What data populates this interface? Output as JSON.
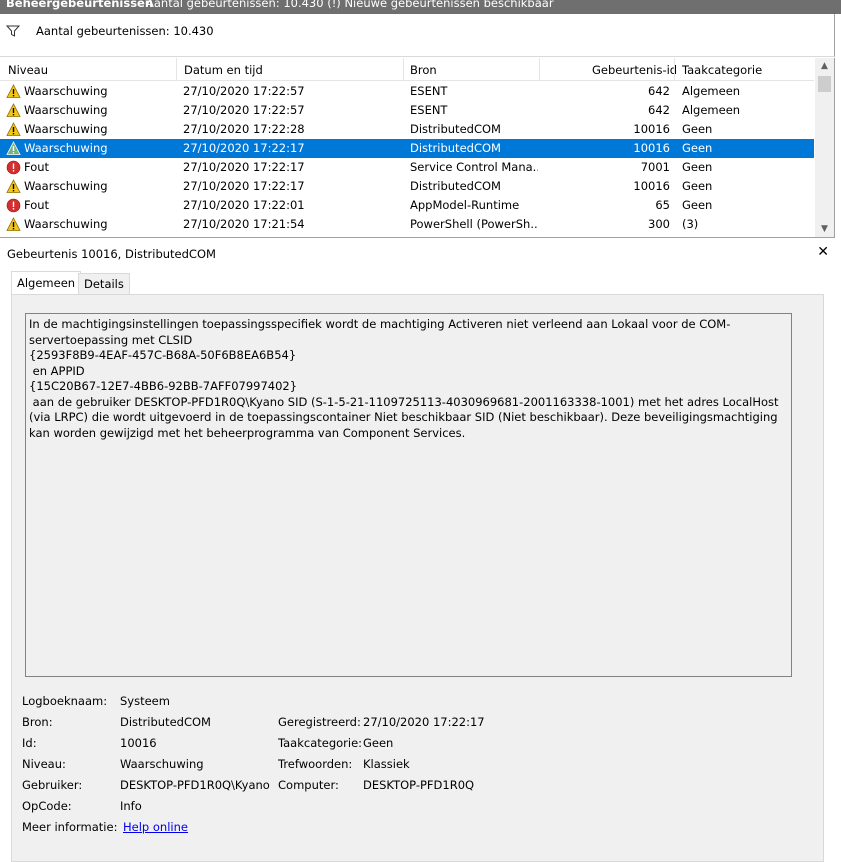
{
  "titlebar": {
    "title": "Beheergebeurtenissen",
    "status": "Aantal gebeurtenissen: 10.430 (!) Nieuwe gebeurtenissen beschikbaar"
  },
  "filterbar": {
    "icon": "filter-icon",
    "count_text": "Aantal gebeurtenissen: 10.430"
  },
  "event_list": {
    "columns": [
      "Niveau",
      "Datum en tijd",
      "Bron",
      "Gebeurtenis-id",
      "Taakcategorie"
    ],
    "rows": [
      {
        "level": "Waarschuwing",
        "icon": "warning-icon",
        "datetime": "27/10/2020 17:22:57",
        "source": "ESENT",
        "event_id": "642",
        "category": "Algemeen",
        "selected": false
      },
      {
        "level": "Waarschuwing",
        "icon": "warning-icon",
        "datetime": "27/10/2020 17:22:57",
        "source": "ESENT",
        "event_id": "642",
        "category": "Algemeen",
        "selected": false
      },
      {
        "level": "Waarschuwing",
        "icon": "warning-icon",
        "datetime": "27/10/2020 17:22:28",
        "source": "DistributedCOM",
        "event_id": "10016",
        "category": "Geen",
        "selected": false
      },
      {
        "level": "Waarschuwing",
        "icon": "warning-icon",
        "datetime": "27/10/2020 17:22:17",
        "source": "DistributedCOM",
        "event_id": "10016",
        "category": "Geen",
        "selected": true
      },
      {
        "level": "Fout",
        "icon": "error-icon",
        "datetime": "27/10/2020 17:22:17",
        "source": "Service Control Mana...",
        "event_id": "7001",
        "category": "Geen",
        "selected": false
      },
      {
        "level": "Waarschuwing",
        "icon": "warning-icon",
        "datetime": "27/10/2020 17:22:17",
        "source": "DistributedCOM",
        "event_id": "10016",
        "category": "Geen",
        "selected": false
      },
      {
        "level": "Fout",
        "icon": "error-icon",
        "datetime": "27/10/2020 17:22:01",
        "source": "AppModel-Runtime",
        "event_id": "65",
        "category": "Geen",
        "selected": false
      },
      {
        "level": "Waarschuwing",
        "icon": "warning-icon",
        "datetime": "27/10/2020 17:21:54",
        "source": "PowerShell (PowerSh...",
        "event_id": "300",
        "category": "(3)",
        "selected": false
      }
    ]
  },
  "detail": {
    "header": "Gebeurtenis 10016, DistributedCOM",
    "close_label": "✕",
    "tabs": [
      "Algemeen",
      "Details"
    ],
    "active_tab": "Algemeen",
    "description": "In de machtigingsinstellingen toepassingsspecifiek wordt de machtiging Activeren niet verleend aan Lokaal voor de COM-servertoepassing met CLSID\n{2593F8B9-4EAF-457C-B68A-50F6B8EA6B54}\n en APPID\n{15C20B67-12E7-4BB6-92BB-7AFF07997402}\n aan de gebruiker DESKTOP-PFD1R0Q\\Kyano SID (S-1-5-21-1109725113-4030969681-2001163338-1001) met het adres LocalHost (via LRPC) die wordt uitgevoerd in de toepassingscontainer Niet beschikbaar SID (Niet beschikbaar). Deze beveiligingsmachtiging kan worden gewijzigd met het beheerprogramma van Component Services.",
    "properties": {
      "logboeknaam_label": "Logboeknaam:",
      "logboeknaam": "Systeem",
      "bron_label": "Bron:",
      "bron": "DistributedCOM",
      "geregistreerd_label": "Geregistreerd:",
      "geregistreerd": "27/10/2020 17:22:17",
      "id_label": "Id:",
      "id": "10016",
      "taakcategorie_label": "Taakcategorie:",
      "taakcategorie": "Geen",
      "niveau_label": "Niveau:",
      "niveau": "Waarschuwing",
      "trefwoorden_label": "Trefwoorden:",
      "trefwoorden": "Klassiek",
      "gebruiker_label": "Gebruiker:",
      "gebruiker": "DESKTOP-PFD1R0Q\\Kyano",
      "computer_label": "Computer:",
      "computer": "DESKTOP-PFD1R0Q",
      "opcode_label": "OpCode:",
      "opcode": "Info",
      "meer_label": "Meer informatie:",
      "meer_link": "Help online"
    }
  },
  "colors": {
    "selection": "#0078d7",
    "warning": "#f5c518",
    "error": "#d32f2f",
    "link": "#0000ee"
  }
}
